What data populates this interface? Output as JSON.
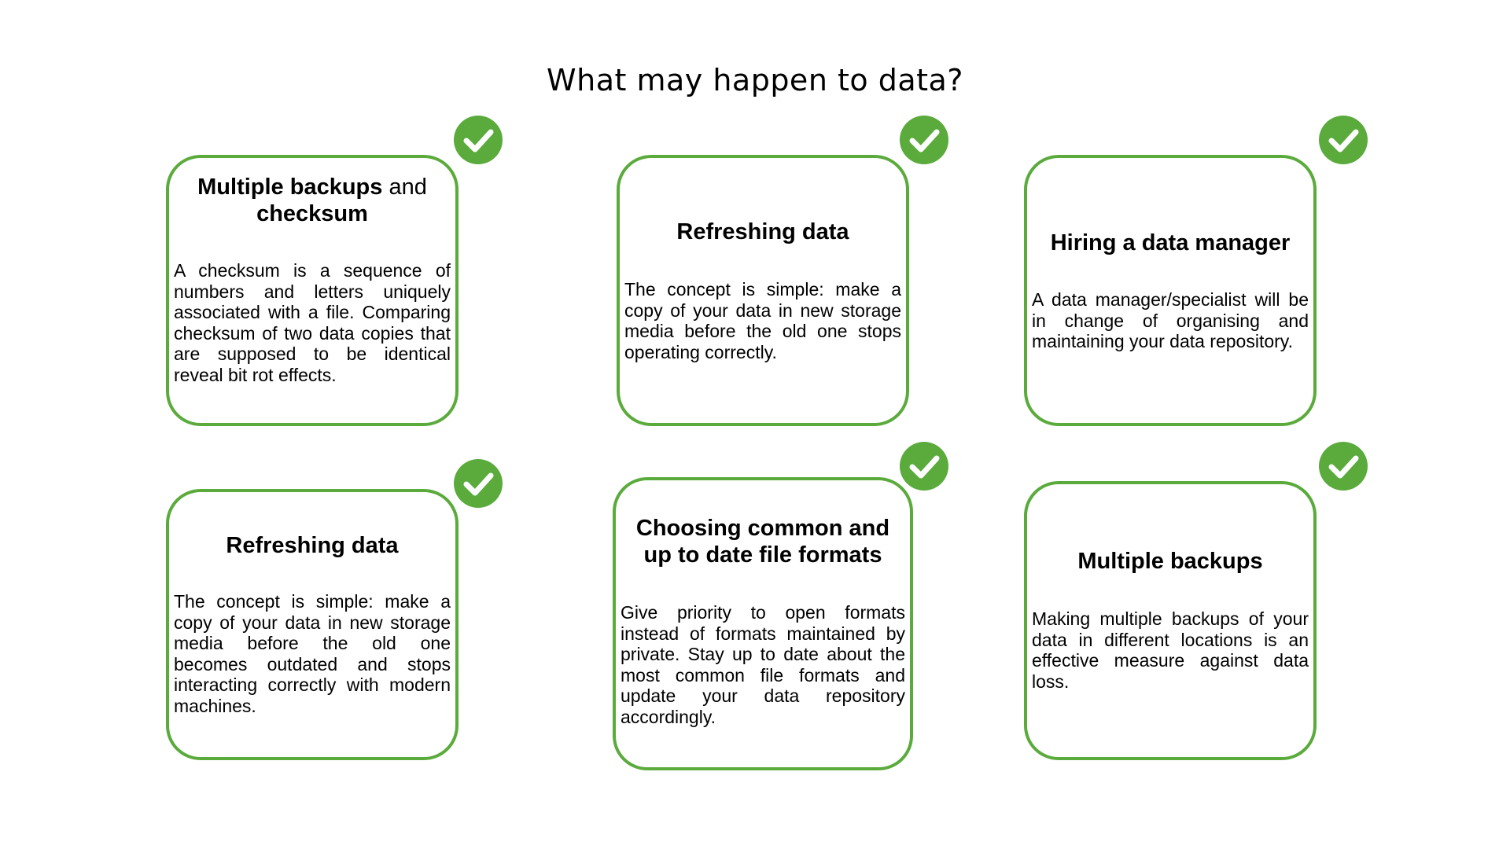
{
  "title": "What may happen to data?",
  "colors": {
    "accent": "#5aab3c",
    "text": "#000000",
    "background": "#ffffff"
  },
  "cards": [
    {
      "heading_bold_1": "Multiple backups",
      "heading_normal": " and",
      "heading_bold_2": "checksum",
      "body": "A checksum is a sequence of numbers and letters uniquely associated with a file. Comparing checksum of two data copies that are supposed to be identical reveal bit rot effects.",
      "badge_icon": "checkmark-icon"
    },
    {
      "heading": "Refreshing data",
      "body": "The concept is simple: make a copy of your data in new storage media before the old one stops operating correctly.",
      "badge_icon": "checkmark-icon"
    },
    {
      "heading": "Hiring a data manager",
      "body": "A data manager/specialist will be in change of organising and maintaining your data repository.",
      "badge_icon": "checkmark-icon"
    },
    {
      "heading": "Refreshing data",
      "body": "The concept is simple: make a copy of your data in new storage media before the old one becomes outdated and stops interacting correctly with modern machines.",
      "badge_icon": "checkmark-icon"
    },
    {
      "heading": "Choosing common and up to date file formats",
      "body": "Give priority to open formats instead of formats maintained by private. Stay up to date about the most common file formats and update your data repository accordingly.",
      "badge_icon": "checkmark-icon"
    },
    {
      "heading": "Multiple backups",
      "body": "Making multiple backups of your data in different locations is an effective measure against data loss.",
      "badge_icon": "checkmark-icon"
    }
  ]
}
